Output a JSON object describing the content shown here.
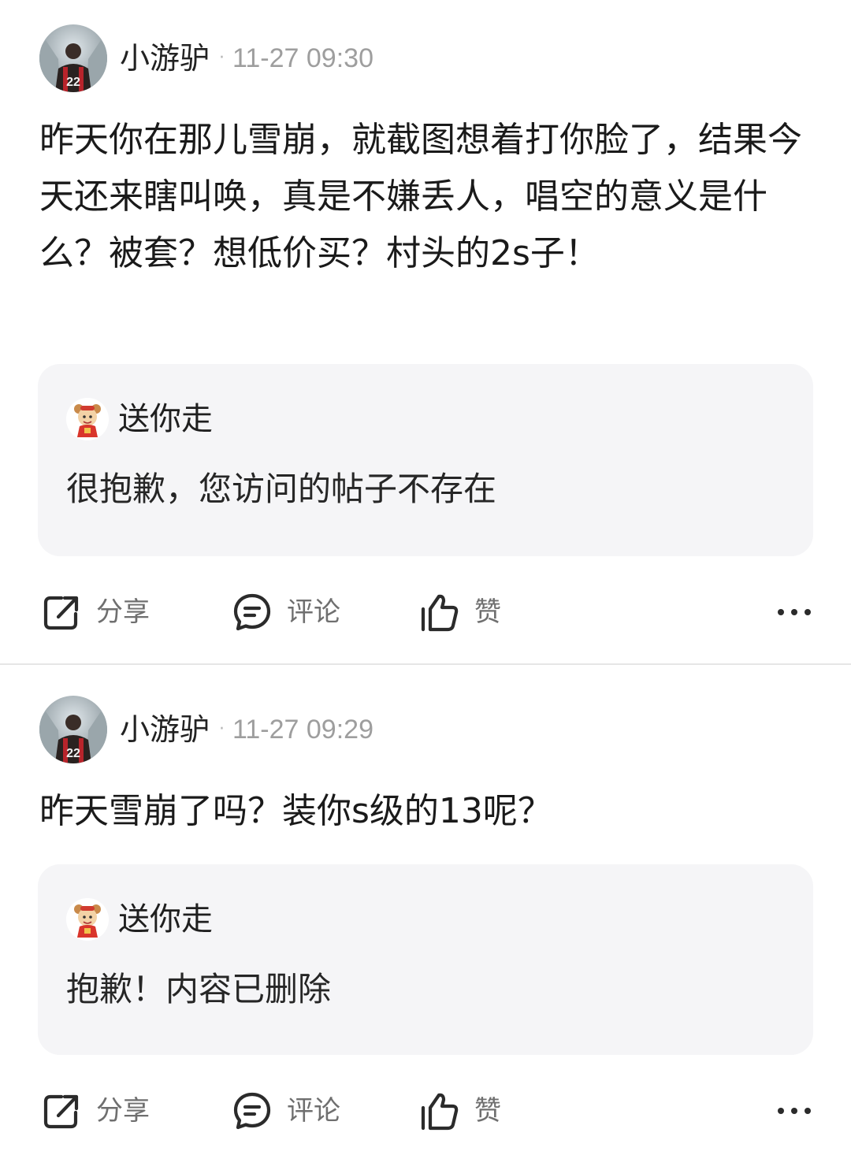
{
  "posts": [
    {
      "author": "小游驴",
      "separator": "·",
      "time": "11-27 09:30",
      "text": "昨天你在那儿雪崩，就截图想着打你脸了，结果今天还来瞎叫唤，真是不嫌丢人，唱空的意义是什么？被套？想低价买？村头的2s子！",
      "quote": {
        "author": "送你走",
        "text": "很抱歉，您访问的帖子不存在"
      },
      "actions": {
        "share": "分享",
        "comment": "评论",
        "like": "赞"
      }
    },
    {
      "author": "小游驴",
      "separator": "·",
      "time": "11-27 09:29",
      "text": "昨天雪崩了吗？装你s级的13呢？",
      "quote": {
        "author": "送你走",
        "text": "抱歉！内容已删除"
      },
      "actions": {
        "share": "分享",
        "comment": "评论",
        "like": "赞"
      }
    }
  ],
  "icons": {
    "share": "share-icon",
    "comment": "comment-icon",
    "like": "thumbs-up-icon",
    "more": "more-icon"
  },
  "avatar_jersey_number": "22"
}
